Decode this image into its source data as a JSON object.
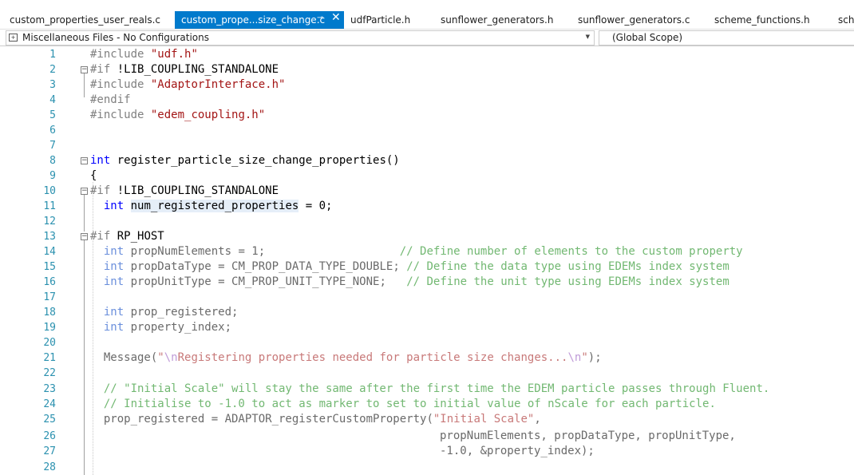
{
  "tabs": [
    {
      "label": "custom_properties_user_reals.c",
      "active": false
    },
    {
      "label": "custom_prope...size_change.c",
      "active": true
    },
    {
      "label": "udfParticle.h",
      "active": false
    },
    {
      "label": "sunflower_generators.h",
      "active": false
    },
    {
      "label": "sunflower_generators.c",
      "active": false
    },
    {
      "label": "scheme_functions.h",
      "active": false
    },
    {
      "label": "sche",
      "active": false
    }
  ],
  "tab_icons": {
    "pin": "pin-icon",
    "close": "close-icon"
  },
  "navbar": {
    "project": "Miscellaneous Files - No Configurations",
    "scope": "(Global Scope)",
    "project_icon": "project-icon",
    "dropdown_icon": "dropdown-arrow-icon"
  },
  "colors": {
    "active_tab": "#007acc",
    "line_numbers": "#2b91af",
    "keyword": "#0000ff",
    "string": "#a31515",
    "comment": "#008000",
    "reference_highlight": "#e5eef8"
  },
  "line_numbers": [
    "1",
    "2",
    "3",
    "4",
    "5",
    "6",
    "7",
    "8",
    "9",
    "10",
    "11",
    "12",
    "13",
    "14",
    "15",
    "16",
    "17",
    "18",
    "19",
    "20",
    "21",
    "22",
    "23",
    "24",
    "25",
    "26",
    "27",
    "28"
  ],
  "code": {
    "l1": {
      "directive": "#include",
      "arg": "\"udf.h\""
    },
    "l2": {
      "directive": "#if",
      "arg": "!LIB_COUPLING_STANDALONE"
    },
    "l3": {
      "directive": "#include",
      "arg": "\"AdaptorInterface.h\""
    },
    "l4": {
      "directive": "#endif"
    },
    "l5": {
      "directive": "#include",
      "arg": "\"edem_coupling.h\""
    },
    "l8": {
      "type": "int",
      "rest": "register_particle_size_change_properties()"
    },
    "l9": {
      "text": "{"
    },
    "l10": {
      "directive": "#if",
      "arg": "!LIB_COUPLING_STANDALONE"
    },
    "l11": {
      "type": "int",
      "ident": "num_registered_properties",
      "rest": " = 0;"
    },
    "l13": {
      "directive": "#if",
      "arg": "RP_HOST"
    },
    "l14": {
      "type": "int",
      "rest": "propNumElements = 1;",
      "pad": "                    ",
      "comment": "// Define number of elements to the custom property"
    },
    "l15": {
      "type": "int",
      "rest": "propDataType = CM_PROP_DATA_TYPE_DOUBLE;",
      "pad": " ",
      "comment": "// Define the data type using EDEMs index system"
    },
    "l16": {
      "type": "int",
      "rest": "propUnitType = CM_PROP_UNIT_TYPE_NONE;",
      "pad": "   ",
      "comment": "// Define the unit type using EDEMs index system"
    },
    "l18": {
      "type": "int",
      "rest": "prop_registered;"
    },
    "l19": {
      "type": "int",
      "rest": "property_index;"
    },
    "l21": {
      "func": "Message(",
      "str1": "\"",
      "esc1": "\\n",
      "str2": "Registering properties needed for particle size changes...",
      "esc2": "\\n",
      "str3": "\"",
      "end": ");"
    },
    "l23": {
      "comment": "// \"Initial Scale\" will stay the same after the first time the EDEM particle passes through Fluent."
    },
    "l24": {
      "comment": "// Initialise to -1.0 to act as marker to set to initial value of nScale for each particle."
    },
    "l25": {
      "rest": "prop_registered = ADAPTOR_registerCustomProperty(",
      "str": "\"Initial Scale\"",
      "end": ","
    },
    "l26": {
      "text": "propNumElements, propDataType, propUnitType,"
    },
    "l27": {
      "text": "-1.0, &property_index);"
    }
  }
}
